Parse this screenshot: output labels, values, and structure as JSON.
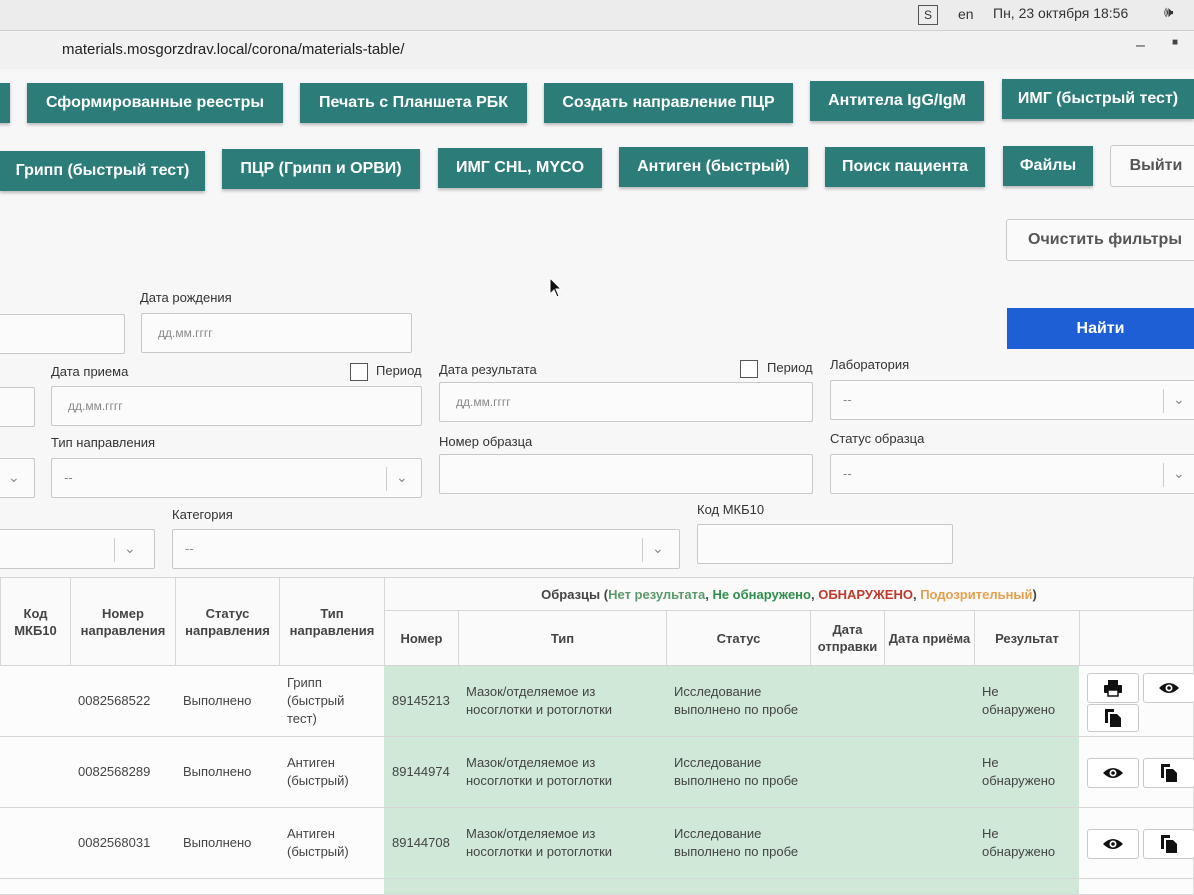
{
  "system": {
    "indicator": "S",
    "lang": "en",
    "datetime": "Пн, 23 октября 18:56",
    "volume_icon": "🕪"
  },
  "browser": {
    "url": "materials.mosgorzdrav.local/corona/materials-table/",
    "minimize": "–",
    "maximize": "■"
  },
  "nav_row1": [
    "Сформированные реестры",
    "Печать с Планшета РБК",
    "Создать направление ПЦР",
    "Антитела IgG/IgM",
    "ИМГ (быстрый тест)"
  ],
  "nav_row2": [
    "Грипп (быстрый тест)",
    "ПЦР (Грипп и ОРВИ)",
    "ИМГ CHL, MYCO",
    "Антиген (быстрый)",
    "Поиск пациента",
    "Файлы"
  ],
  "logout_label": "Выйти",
  "clear_filters_label": "Очистить фильтры",
  "find_label": "Найти",
  "filters": {
    "birth_date_label": "Дата рождения",
    "birth_date_placeholder": "дд.мм.гггг",
    "receipt_date_label": "Дата приема",
    "receipt_date_placeholder": "дд.мм.гггг",
    "receipt_period_label": "Период",
    "result_date_label": "Дата результата",
    "result_date_placeholder": "дд.мм.гггг",
    "result_period_label": "Период",
    "lab_label": "Лаборатория",
    "lab_value": "--",
    "direction_type_label": "Тип направления",
    "direction_type_value": "--",
    "sample_number_label": "Номер образца",
    "sample_status_label": "Статус образца",
    "sample_status_value": "--",
    "category_label": "Категория",
    "category_value": "--",
    "mkb10_label": "Код МКБ10"
  },
  "table": {
    "headers": {
      "mkb": "Код МКБ10",
      "dir_number": "Номер направления",
      "dir_status": "Статус направления",
      "dir_type": "Тип направления",
      "samples_title": "Образцы",
      "legend_open": "(",
      "legend_none": "Нет результата",
      "legend_sep1": ", ",
      "legend_not_found": "Не обнаружено",
      "legend_sep2": ", ",
      "legend_found": "ОБНАРУЖЕНО",
      "legend_sep3": ", ",
      "legend_suspicious": "Подозрительный",
      "legend_close": ")",
      "number": "Номер",
      "type": "Тип",
      "status": "Статус",
      "sent_date": "Дата отправки",
      "received_date": "Дата приёма",
      "result": "Результат"
    },
    "rows": [
      {
        "dir_number": "0082568522",
        "dir_status": "Выполнено",
        "dir_type": "Грипп (быстрый тест)",
        "number": "89145213",
        "type": "Мазок/отделяемое из носоглотки и ротоглотки",
        "status": "Исследование выполнено по пробе",
        "result": "Не обнаружено"
      },
      {
        "dir_number": "0082568289",
        "dir_status": "Выполнено",
        "dir_type": "Антиген (быстрый)",
        "number": "89144974",
        "type": "Мазок/отделяемое из носоглотки и ротоглотки",
        "status": "Исследование выполнено по пробе",
        "result": "Не обнаружено"
      },
      {
        "dir_number": "0082568031",
        "dir_status": "Выполнено",
        "dir_type": "Антиген (быстрый)",
        "number": "89144708",
        "type": "Мазок/отделяемое из носоглотки и ротоглотки",
        "status": "Исследование выполнено по пробе",
        "result": "Не обнаружено"
      }
    ]
  },
  "icons": {
    "print": "print-icon",
    "view": "eye-icon",
    "copy": "copy-icon"
  }
}
